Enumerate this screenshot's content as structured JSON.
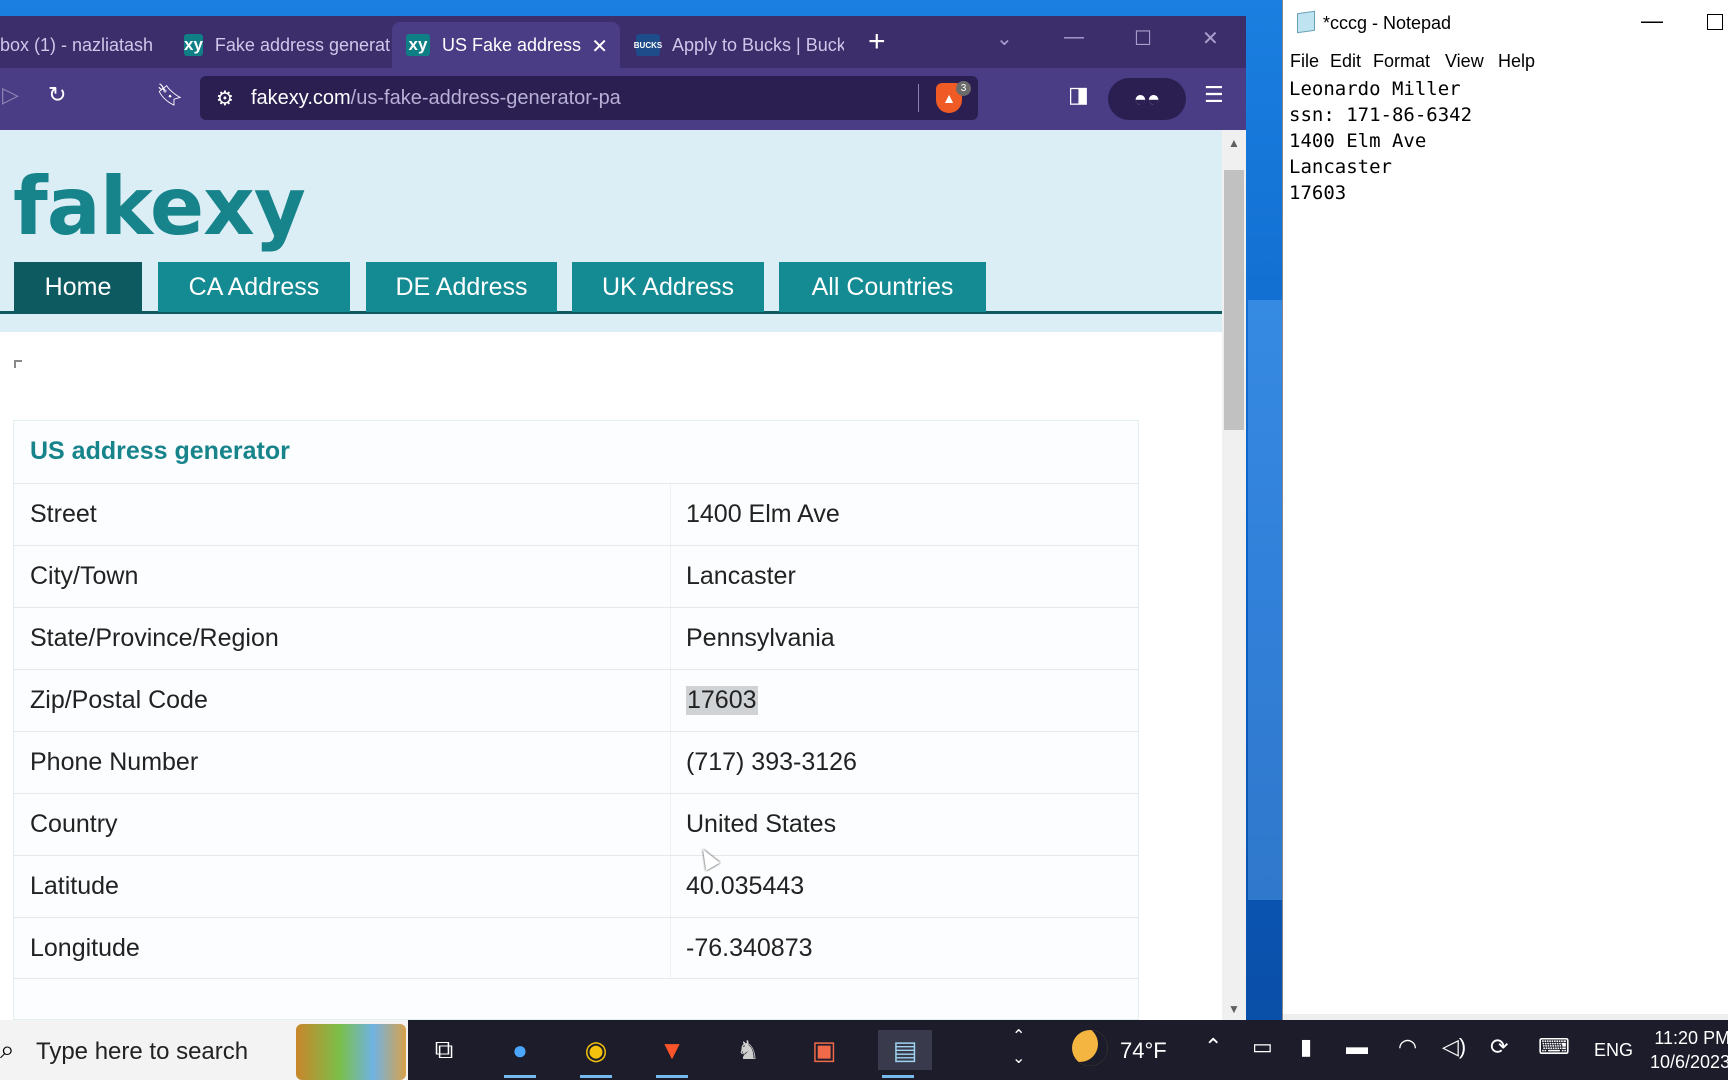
{
  "browser": {
    "tabs": [
      {
        "title": "box (1) - nazliatash"
      },
      {
        "title": "Fake address generat"
      },
      {
        "title": "US Fake address"
      },
      {
        "title": "Apply to Bucks | Buck"
      }
    ],
    "favicon_xy": "xy",
    "favicon_bucks": "BUCKS",
    "new_tab": "+",
    "url_domain": "fakexy.com",
    "url_path": "/us-fake-address-generator-pa",
    "shield_count": "3"
  },
  "site": {
    "logo": "fakexy",
    "nav": [
      "Home",
      "CA Address",
      "DE Address",
      "UK Address",
      "All Countries"
    ],
    "card_title": "US address generator",
    "rows": [
      {
        "label": "Street",
        "value": "1400 Elm Ave"
      },
      {
        "label": "City/Town",
        "value": "Lancaster"
      },
      {
        "label": "State/Province/Region",
        "value": "Pennsylvania"
      },
      {
        "label": "Zip/Postal Code",
        "value": "17603"
      },
      {
        "label": "Phone Number",
        "value": "(717) 393-3126"
      },
      {
        "label": "Country",
        "value": "United States"
      },
      {
        "label": "Latitude",
        "value": "40.035443"
      },
      {
        "label": "Longitude",
        "value": "-76.340873"
      }
    ]
  },
  "notepad": {
    "title": "*cccg - Notepad",
    "menu": [
      "File",
      "Edit",
      "Format",
      "View",
      "Help"
    ],
    "lines": [
      "Leonardo Miller",
      "ssn: 171-86-6342",
      "1400 Elm Ave",
      "Lancaster",
      "17603"
    ]
  },
  "taskbar": {
    "search_placeholder": "Type here to search",
    "temperature": "74°F",
    "language": "ENG",
    "time": "11:20 PM",
    "date": "10/6/2023"
  },
  "colors": {
    "brand_teal": "#17838b",
    "nav_active": "#0e5a61",
    "browser_chrome": "#4a3c85"
  }
}
